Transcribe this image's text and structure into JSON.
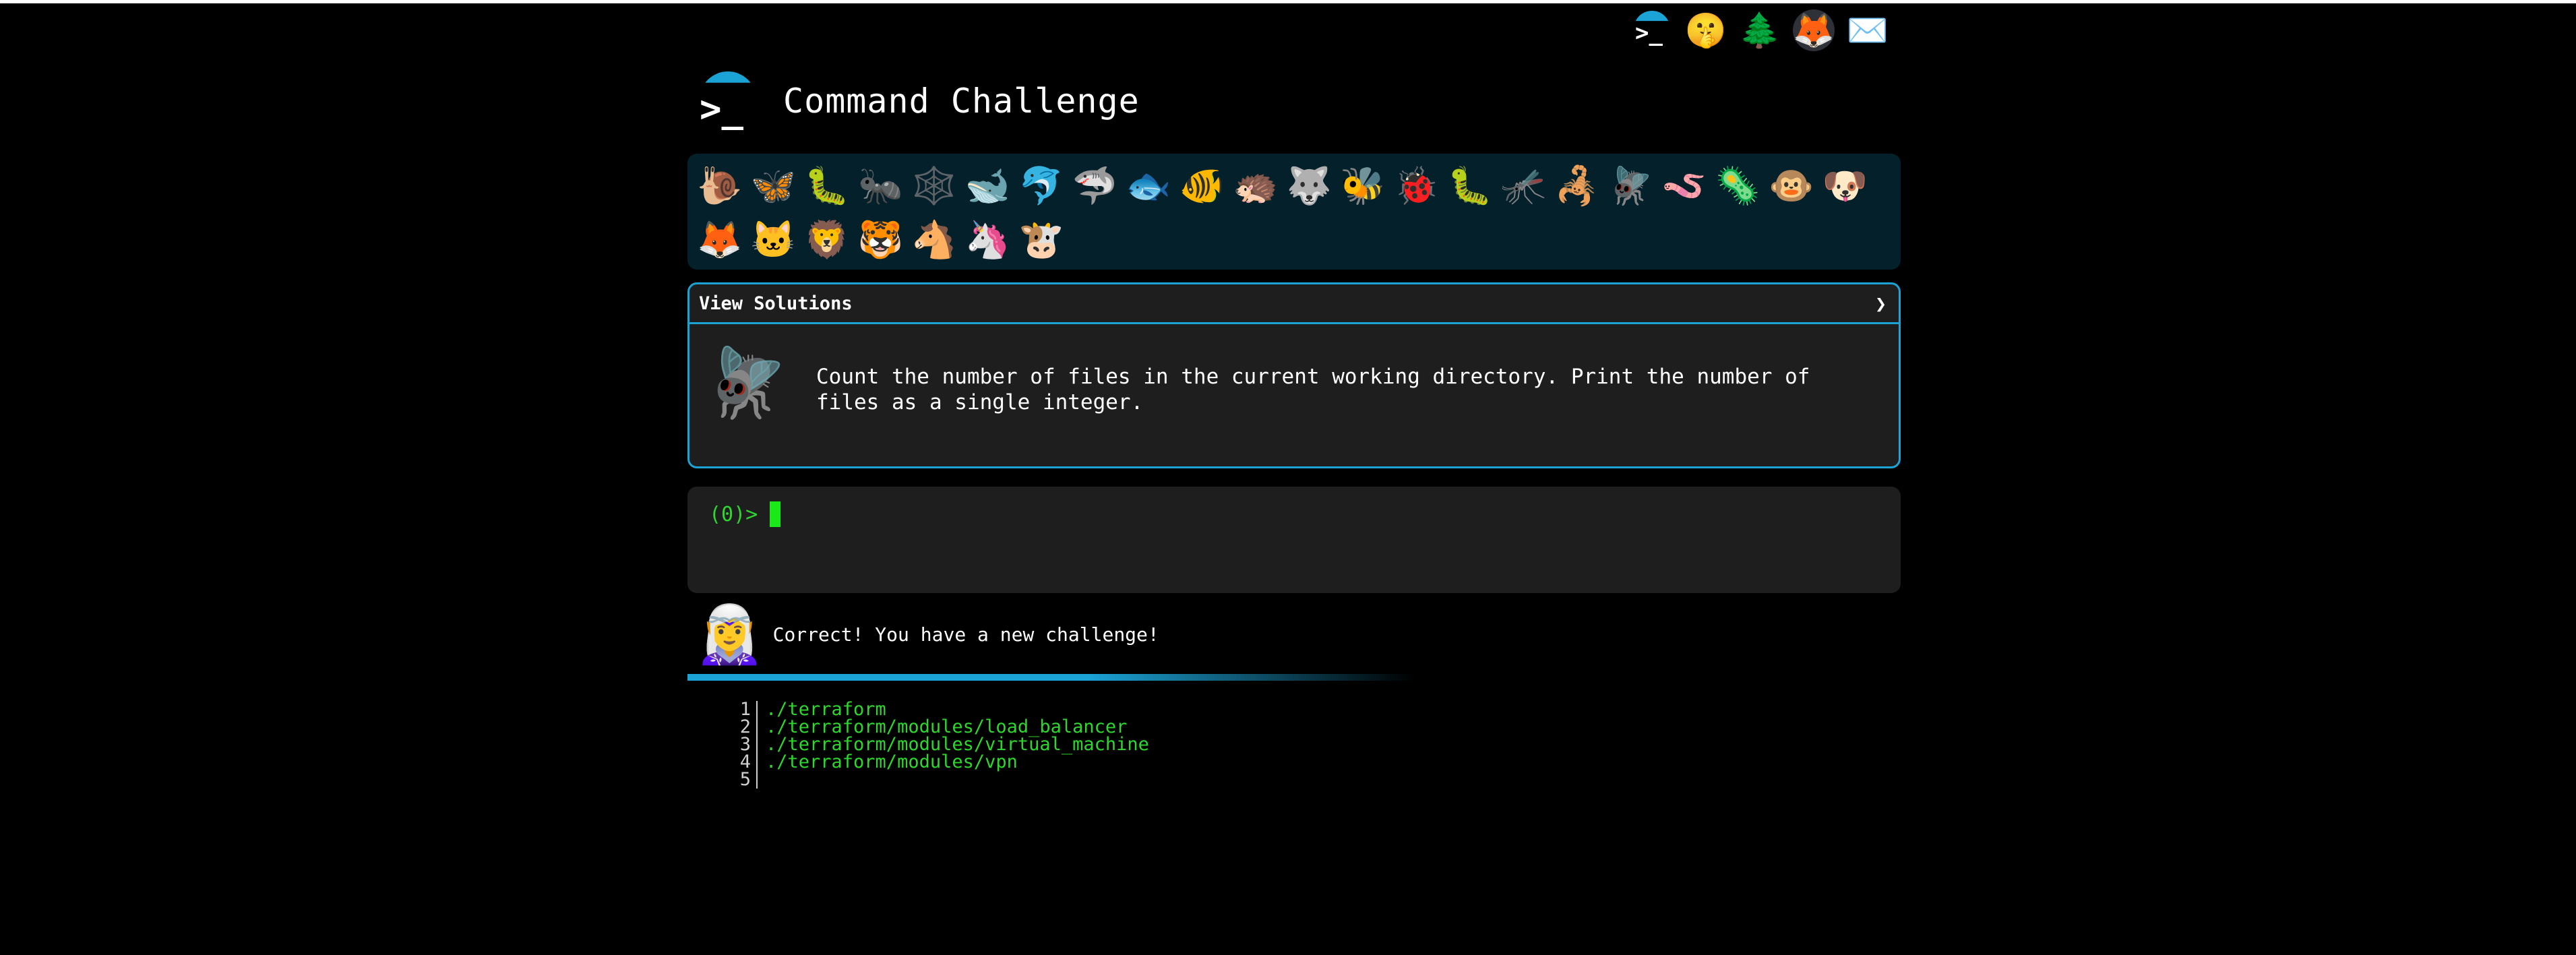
{
  "app": {
    "title": "Command Challenge",
    "logo_prompt": ">_"
  },
  "top_links": [
    {
      "name": "commandchallenge-logo-icon",
      "glyph": ">_"
    },
    {
      "name": "shushing-face-icon",
      "glyph": "🤫"
    },
    {
      "name": "evergreen-tree-icon",
      "glyph": "🌲"
    },
    {
      "name": "gitlab-icon",
      "glyph": "🦊"
    },
    {
      "name": "envelope-icon",
      "glyph": "✉️"
    }
  ],
  "challenges": [
    {
      "name": "snail",
      "glyph": "🐌"
    },
    {
      "name": "butterfly",
      "glyph": "🦋"
    },
    {
      "name": "bug",
      "glyph": "🐛"
    },
    {
      "name": "ant",
      "glyph": "🐜"
    },
    {
      "name": "spider-web",
      "glyph": "🕸️"
    },
    {
      "name": "whale",
      "glyph": "🐋"
    },
    {
      "name": "dolphin",
      "glyph": "🐬"
    },
    {
      "name": "shark",
      "glyph": "🦈"
    },
    {
      "name": "fish",
      "glyph": "🐟"
    },
    {
      "name": "tropical-fish",
      "glyph": "🐠"
    },
    {
      "name": "hedgehog",
      "glyph": "🦔"
    },
    {
      "name": "wolf",
      "glyph": "🐺"
    },
    {
      "name": "bee",
      "glyph": "🐝"
    },
    {
      "name": "lady-beetle",
      "glyph": "🐞"
    },
    {
      "name": "worm",
      "glyph": "🐛"
    },
    {
      "name": "mosquito",
      "glyph": "🦟"
    },
    {
      "name": "scorpion",
      "glyph": "🦂"
    },
    {
      "name": "fly",
      "glyph": "🪰"
    },
    {
      "name": "snake",
      "glyph": "🪱"
    },
    {
      "name": "microbe",
      "glyph": "🦠"
    },
    {
      "name": "monkey",
      "glyph": "🐵"
    },
    {
      "name": "dog",
      "glyph": "🐶"
    },
    {
      "name": "fox",
      "glyph": "🦊"
    },
    {
      "name": "cat",
      "glyph": "🐱"
    },
    {
      "name": "lion",
      "glyph": "🦁"
    },
    {
      "name": "tiger",
      "glyph": "🐯"
    },
    {
      "name": "horse",
      "glyph": "🐴"
    },
    {
      "name": "unicorn",
      "glyph": "🦄"
    },
    {
      "name": "cow",
      "glyph": "🐮"
    }
  ],
  "challenge_panel": {
    "view_solutions_label": "View Solutions",
    "chevron": "❯",
    "current_icon": "🪰",
    "description": "Count the number of files in the current working directory. Print the number of files as a single integer."
  },
  "terminal": {
    "prompt": "(0)>",
    "input_value": ""
  },
  "message": {
    "avatar": "🧝‍♀️",
    "text": "Correct! You have a new challenge!"
  },
  "output": {
    "lines": [
      {
        "num": "1",
        "text": "./terraform"
      },
      {
        "num": "2",
        "text": "./terraform/modules/load_balancer"
      },
      {
        "num": "3",
        "text": "./terraform/modules/virtual_machine"
      },
      {
        "num": "4",
        "text": "./terraform/modules/vpn"
      },
      {
        "num": "5",
        "text": ""
      }
    ]
  },
  "colors": {
    "accent": "#1ba3d6",
    "terminal_green": "#2ed62e",
    "panel_bg": "#1e1e1e",
    "animals_bg": "#04202b"
  }
}
